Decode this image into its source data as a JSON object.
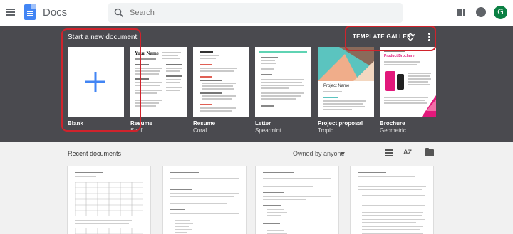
{
  "app": {
    "title": "Docs",
    "logo_icon": "docs-icon"
  },
  "search": {
    "placeholder": "Search"
  },
  "account": {
    "initial": "G",
    "avatar_color": "#0b8043"
  },
  "templates": {
    "section_title": "Start a new document",
    "gallery_label": "TEMPLATE GALLERY",
    "items": [
      {
        "name": "Blank",
        "sub": ""
      },
      {
        "name": "Resume",
        "sub": "Serif"
      },
      {
        "name": "Resume",
        "sub": "Coral"
      },
      {
        "name": "Letter",
        "sub": "Spearmint"
      },
      {
        "name": "Project proposal",
        "sub": "Tropic"
      },
      {
        "name": "Brochure",
        "sub": "Geometric"
      }
    ],
    "thumb_text": {
      "resume_serif_name": "Your Name",
      "proposal_title": "Project Name",
      "brochure_title": "Product Brochure"
    }
  },
  "recent": {
    "title": "Recent documents",
    "owner_filter": "Owned by anyone",
    "sort_label": "AZ"
  },
  "colors": {
    "band_bg": "#4a4a4f",
    "accent_blue": "#4285f4",
    "highlight_red": "#d0232c",
    "spearmint": "#5fd3b3",
    "tropic_teal": "#5bc4bf",
    "brochure_pink": "#e2187b"
  }
}
